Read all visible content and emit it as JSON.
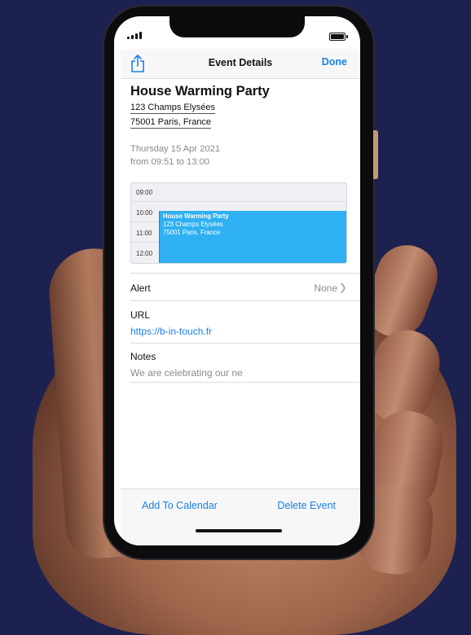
{
  "navbar": {
    "title": "Event Details",
    "done_label": "Done",
    "share_icon": "share-icon"
  },
  "event": {
    "title": "House Warming Party",
    "address_line1": "123 Champs Elysées",
    "address_line2": "75001 Paris, France",
    "date": "Thursday 15 Apr 2021",
    "time_range": "from 09:51 to 13:00"
  },
  "mini_calendar": {
    "times": [
      "09:00",
      "10:00",
      "11:00",
      "12:00"
    ],
    "event_title": "House Warming Party",
    "event_address1": "123 Champs Elysées",
    "event_address2": "75001 Paris, France",
    "event_color": "#2fb0f2"
  },
  "alert": {
    "label": "Alert",
    "value": "None"
  },
  "url": {
    "label": "URL",
    "value": "https://b-in-touch.fr"
  },
  "notes": {
    "label": "Notes",
    "value": "We are celebrating our ne"
  },
  "toolbar": {
    "add_label": "Add To Calendar",
    "delete_label": "Delete Event"
  },
  "colors": {
    "accent": "#1a80e8",
    "background": "#1c2150",
    "secondary_text": "#8a8a8e"
  }
}
